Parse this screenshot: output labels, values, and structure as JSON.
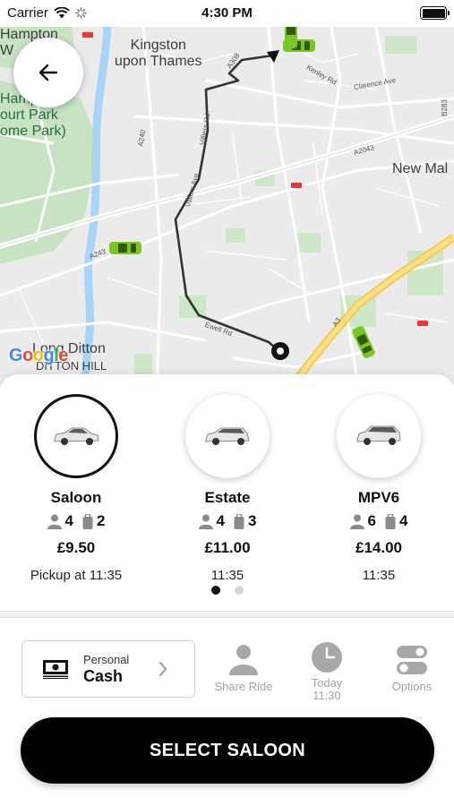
{
  "status_bar": {
    "carrier": "Carrier",
    "time": "4:30 PM"
  },
  "map": {
    "labels": {
      "hampton_w": "Hampton\nW",
      "kingston": "Kingston\nupon Thames",
      "hampton_court": "Hampton\nourt Park\nome Park)",
      "new_malden": "New Mal",
      "long_ditton": "Long Ditton",
      "ditton_hill": "DITTON HILL",
      "a240": "A240",
      "a243": "A243",
      "a2043": "A2043",
      "a3": "A3",
      "b283": "B283",
      "a308": "A308",
      "kenley_rd": "Kenley Rd",
      "clarence_ave": "Clarence Ave",
      "villiers_rd": "Villiers Rd",
      "villiers_ave": "Villiers Ave",
      "ewell_rd": "Ewell Rd"
    },
    "google": "Google"
  },
  "vehicle_options": [
    {
      "name": "Saloon",
      "passengers": "4",
      "bags": "2",
      "price": "£9.50",
      "pickup": "Pickup at 11:35"
    },
    {
      "name": "Estate",
      "passengers": "4",
      "bags": "3",
      "price": "£11.00",
      "pickup": "11:35"
    },
    {
      "name": "MPV6",
      "passengers": "6",
      "bags": "4",
      "price": "£14.00",
      "pickup": "11:35"
    }
  ],
  "payment": {
    "type": "Personal",
    "method": "Cash"
  },
  "toolbar": {
    "share_ride": "Share Ride",
    "today_line1": "Today",
    "today_line2": "11:30",
    "options": "Options"
  },
  "cta_label": "SELECT SALOON",
  "colors": {
    "accent": "#000000",
    "car_green": "#7cc623",
    "route": "#333333",
    "road_yellow": "#f4d35e",
    "park_green": "#c8e6c9",
    "river": "#aadaff"
  }
}
